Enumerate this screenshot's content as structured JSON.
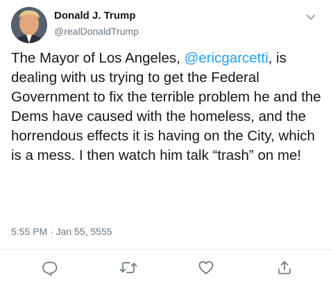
{
  "tweet": {
    "author_name": "Donald J. Trump",
    "author_handle": "@realDonaldTrump",
    "text_before_mention": "The Mayor of Los Angeles, ",
    "mention": "@ericgarcetti",
    "text_after_mention": ", is dealing with us trying to get the Federal Government to fix the terrible problem he and the Dems have caused with the homeless, and the horrendous effects it is having on the City, which is a mess. I then watch him talk “trash” on me!",
    "timestamp": "5:55 PM · Jan 55, 5555"
  },
  "icons": {
    "more": "chevron-down-icon",
    "reply": "reply-icon",
    "retweet": "retweet-icon",
    "like": "heart-icon",
    "share": "share-icon"
  },
  "colors": {
    "text": "#14171a",
    "secondary": "#657786",
    "mention": "#1da1f2",
    "divider": "#e6ecf0"
  }
}
